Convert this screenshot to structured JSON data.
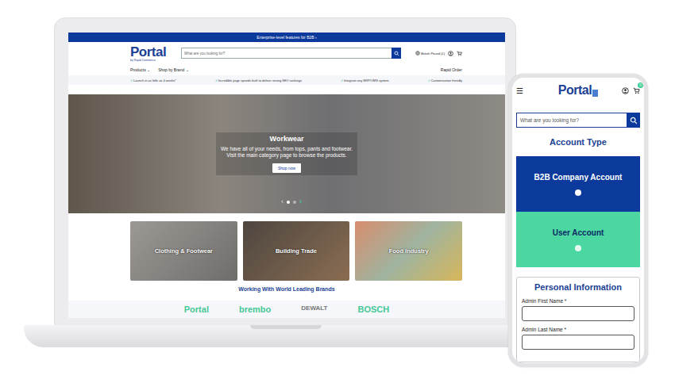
{
  "laptop": {
    "announcement": "Enterprise-level features for B2B ›",
    "logo": {
      "name": "Portal",
      "tagline": "by Rapid Commerce"
    },
    "search": {
      "placeholder": "What are you looking for?"
    },
    "currency": "British Pound (£)",
    "nav": [
      {
        "label": "Products",
        "icon": "⌄"
      },
      {
        "label": "Shop by Brand",
        "icon": "⌄"
      }
    ],
    "rapid_order": "Rapid Order",
    "check": "✓",
    "features": [
      "Launch in as little as 4 weeks*",
      "Incredible page speeds built to deliver strong SEO rankings",
      "Integrate any ERP/OMS system",
      "Customisation friendly"
    ],
    "hero": {
      "title": "Workwear",
      "lines": [
        "We have all of your needs, from tops, pants and footwear.",
        "Visit the main category page to browse the products."
      ],
      "button": "Shop now",
      "prev": "‹",
      "next": "›",
      "slides": [
        {
          "selected": true
        },
        {
          "selected": false
        }
      ]
    },
    "categories": [
      "Clothing & Footwear",
      "Building Trade",
      "Food Industry"
    ],
    "brands_title": "Working With World Leading Brands",
    "brands": [
      "Portal",
      "brembo",
      "DEWALT",
      "BOSCH"
    ]
  },
  "phone": {
    "menu": "☰",
    "logo": "Portal",
    "cart_count": "0",
    "search": {
      "placeholder": "What are you looking for?"
    },
    "account_title": "Account Type",
    "account_types": [
      {
        "label": "B2B Company Account",
        "selected": true,
        "color": "#0b3a9c"
      },
      {
        "label": "User Account",
        "selected": false,
        "color": "#4bd6a2"
      }
    ],
    "section_title": "Personal Information",
    "fields": [
      "Admin First Name *",
      "Admin Last Name *"
    ]
  }
}
